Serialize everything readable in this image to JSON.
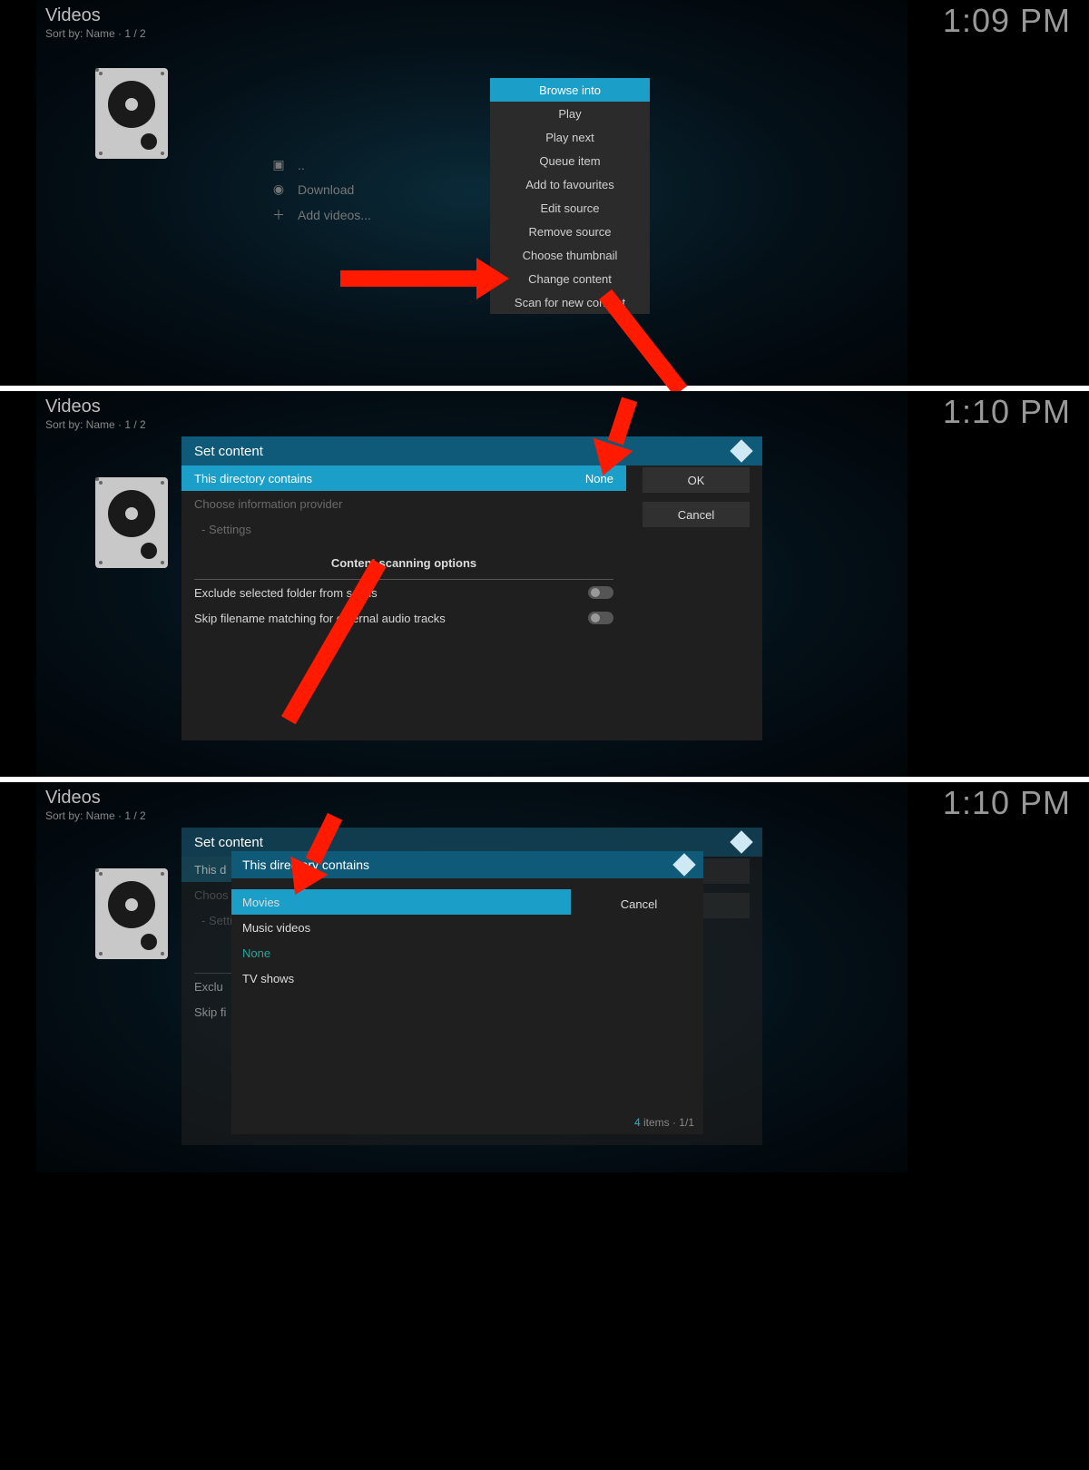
{
  "panels": {
    "p1": {
      "title": "Videos",
      "sub": "Sort by: Name  ·  1 / 2",
      "clock": "1:09 PM",
      "flist": {
        "up": "..",
        "download": "Download",
        "add": "Add videos..."
      },
      "ctx": [
        "Browse into",
        "Play",
        "Play next",
        "Queue item",
        "Add to favourites",
        "Edit source",
        "Remove source",
        "Choose thumbnail",
        "Change content",
        "Scan for new content"
      ]
    },
    "p2": {
      "title": "Videos",
      "sub": "Sort by: Name  ·  1 / 2",
      "clock": "1:10 PM",
      "dlg_title": "Set content",
      "row_dir": "This directory contains",
      "row_dir_val": "None",
      "row_provider": "Choose information provider",
      "row_settings": "- Settings",
      "section": "Content scanning options",
      "opt_exclude": "Exclude selected folder from scans",
      "opt_skip": "Skip filename matching for external audio tracks",
      "btn_ok": "OK",
      "btn_cancel": "Cancel"
    },
    "p3": {
      "title": "Videos",
      "sub": "Sort by: Name  ·  1 / 2",
      "clock": "1:10 PM",
      "dlg_title": "Set content",
      "bg_dir": "This d",
      "bg_provider": "Choos",
      "bg_settings": "- Setti",
      "bg_exclude": "Exclu",
      "bg_skip": "Skip fi",
      "pop_title": "This directory contains",
      "items": [
        "Movies",
        "Music videos",
        "None",
        "TV shows"
      ],
      "footer_count": "4",
      "footer_label": " items  ·  1/1",
      "cancel": "Cancel"
    }
  }
}
